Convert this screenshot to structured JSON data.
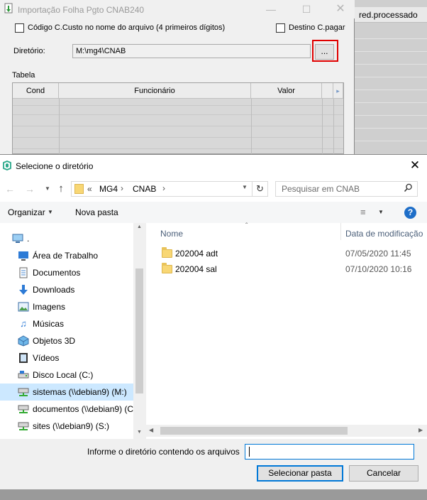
{
  "background_window": {
    "title": "Importação Folha Pgto CNAB240",
    "checkbox_custo_label": "Código C.Custo no nome do arquivo (4 primeiros dígitos)",
    "checkbox_destino_label": "Destino C.pagar",
    "diretorio_label": "Diretório:",
    "diretorio_value": "M:\\mg4\\CNAB",
    "browse_label": "...",
    "tabela_label": "Tabela",
    "grid_columns": [
      "Cond",
      "Funcionário",
      "Valor"
    ],
    "right_header": "red.processado"
  },
  "dialog": {
    "title": "Selecione o diretório",
    "breadcrumb": {
      "prefix": "«",
      "items": [
        "MG4",
        "CNAB"
      ]
    },
    "search_placeholder": "Pesquisar em CNAB",
    "toolbar": {
      "organize_label": "Organizar",
      "new_folder_label": "Nova pasta"
    },
    "nav_items": [
      {
        "label": ".",
        "icon": "computer-icon"
      },
      {
        "label": "Área de Trabalho",
        "icon": "desktop-icon"
      },
      {
        "label": "Documentos",
        "icon": "documents-icon"
      },
      {
        "label": "Downloads",
        "icon": "downloads-icon"
      },
      {
        "label": "Imagens",
        "icon": "images-icon"
      },
      {
        "label": "Músicas",
        "icon": "music-icon"
      },
      {
        "label": "Objetos 3D",
        "icon": "objects3d-icon"
      },
      {
        "label": "Vídeos",
        "icon": "videos-icon"
      },
      {
        "label": "Disco Local (C:)",
        "icon": "drive-icon"
      },
      {
        "label": "sistemas (\\\\debian9) (M:)",
        "icon": "network-drive-icon",
        "selected": true
      },
      {
        "label": "documentos (\\\\debian9) (C",
        "icon": "network-drive-icon"
      },
      {
        "label": "sites (\\\\debian9) (S:)",
        "icon": "network-drive-icon"
      }
    ],
    "columns": {
      "name": "Nome",
      "modified": "Data de modificação"
    },
    "files": [
      {
        "name": "202004 adt",
        "modified": "07/05/2020 11:45"
      },
      {
        "name": "202004 sal",
        "modified": "07/10/2020 10:16"
      }
    ],
    "folder_prompt_label": "Informe o diretório contendo os arquivos",
    "folder_prompt_value": "",
    "select_button": "Selecionar pasta",
    "cancel_button": "Cancelar"
  },
  "colors": {
    "highlight_red": "#e00000",
    "selection_blue": "#cce8ff",
    "accent_blue": "#0078d7",
    "folder_yellow": "#f8d775"
  }
}
